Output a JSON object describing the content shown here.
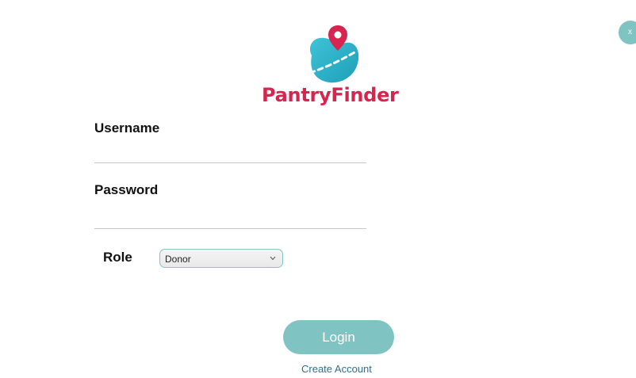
{
  "window": {
    "close_label": "x"
  },
  "brand": {
    "name": "PantryFinder",
    "logo_icon": "map-pin-blob-icon",
    "colors": {
      "brand_red": "#d6254f",
      "accent_teal": "#7fc4c2"
    }
  },
  "form": {
    "username": {
      "label": "Username",
      "value": ""
    },
    "password": {
      "label": "Password",
      "value": ""
    },
    "role": {
      "label": "Role",
      "selected": "Donor"
    }
  },
  "actions": {
    "login_label": "Login",
    "create_account_label": "Create Account"
  }
}
